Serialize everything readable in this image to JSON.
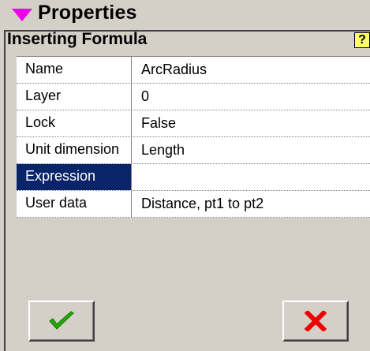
{
  "panel": {
    "title": "Properties",
    "collapse_icon": "triangle-down-icon",
    "collapse_color": "#ee00ee"
  },
  "dialog": {
    "title": "Inserting Formula",
    "help_label": "?",
    "help_icon": "help-icon"
  },
  "properties": [
    {
      "label": "Name",
      "value": "ArcRadius"
    },
    {
      "label": "Layer",
      "value": "0"
    },
    {
      "label": "Lock",
      "value": "False"
    },
    {
      "label": "Unit dimension",
      "value": "Length"
    },
    {
      "label": "Expression",
      "value": "",
      "selected": true
    },
    {
      "label": "User data",
      "value": "Distance, pt1 to pt2"
    }
  ],
  "buttons": {
    "ok_icon": "checkmark-icon",
    "ok_color": "#22aa00",
    "cancel_icon": "x-icon",
    "cancel_color": "#ee0000"
  },
  "colors": {
    "selection": "#0a246a",
    "background": "#d4d0c8"
  }
}
